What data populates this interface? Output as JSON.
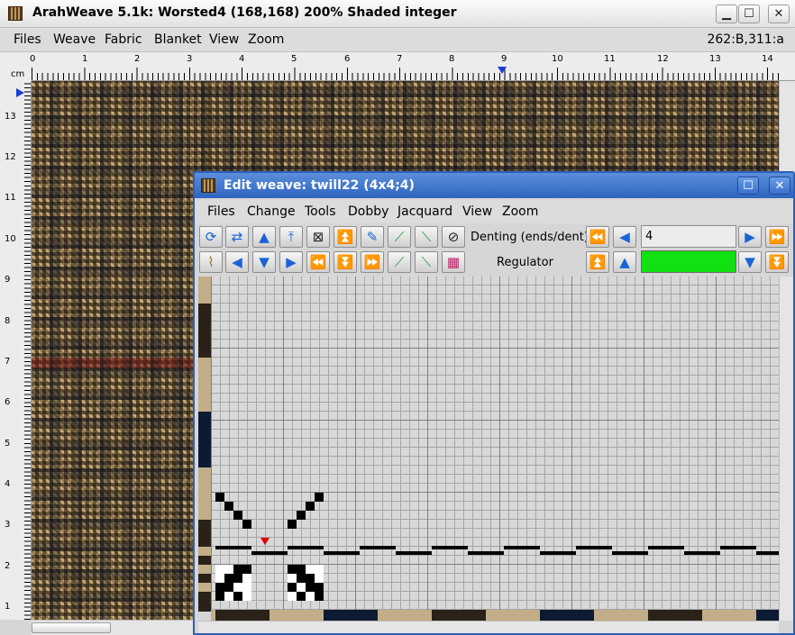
{
  "main": {
    "title": "ArahWeave 5.1k: Worsted4 (168,168) 200% Shaded integer",
    "menu": [
      "Files",
      "Weave",
      "Fabric",
      "Blanket",
      "View",
      "Zoom"
    ],
    "coords": "262:B,311:a",
    "minimize": "▁",
    "maximize": "☐",
    "close": "✕",
    "ruler_unit": "cm",
    "hruler_labels": [
      "0",
      "1",
      "2",
      "3",
      "4",
      "5",
      "6",
      "7",
      "8",
      "9",
      "10",
      "11",
      "12",
      "13",
      "14"
    ],
    "vruler_labels": [
      "13",
      "12",
      "11",
      "10",
      "9",
      "8",
      "7",
      "6",
      "5",
      "4",
      "3",
      "2",
      "1"
    ]
  },
  "dialog": {
    "title": "Edit weave: twill22 (4x4;4)",
    "maximize": "☐",
    "close": "✕",
    "menu": [
      "Files",
      "Change",
      "Tools",
      "Dobby",
      "Jacquard",
      "View",
      "Zoom"
    ],
    "denting_label": "Denting (ends/dent)",
    "denting_value": "4",
    "regulator_label": "Regulator",
    "regulator_color": "#11e011"
  },
  "toolbar": {
    "row1": [
      "refresh-icon",
      "swap-icon",
      "arrow-up-icon",
      "move-up-icon",
      "clear-icon",
      "double-up-icon",
      "paint-icon",
      "twill-right-icon",
      "twill-left-icon",
      "circle-slash-icon"
    ],
    "row2": [
      "broom-icon",
      "arrow-left-icon",
      "arrow-down-icon",
      "arrow-right-icon",
      "double-left-icon",
      "double-down-icon",
      "double-right-icon",
      "twill-up-icon",
      "twill-down-icon",
      "pattern-icon"
    ]
  },
  "colors": {
    "title_blue": "#2e64bf",
    "warp_dark": "#2a2218",
    "warp_navy": "#0d1a33",
    "warp_tan": "#c2ae88"
  }
}
